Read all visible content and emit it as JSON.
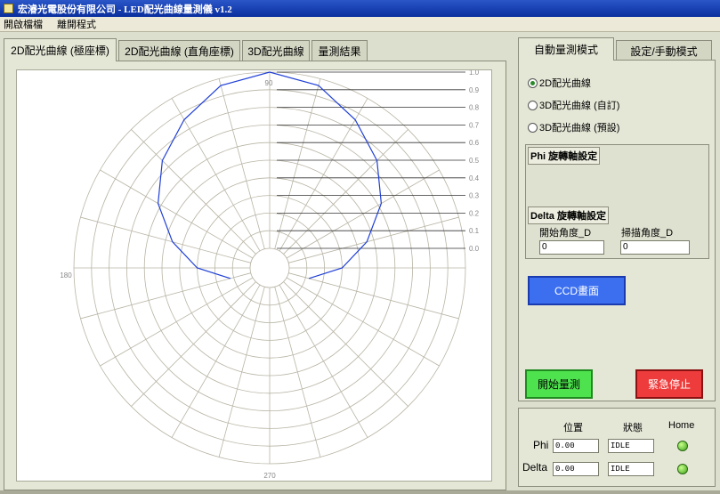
{
  "window": {
    "title": "宏濬光電股份有限公司 - LED配光曲線量測儀 v1.2"
  },
  "menu": [
    "開啟檔檔",
    "離開程式"
  ],
  "left_tabs": [
    "2D配光曲線 (極座標)",
    "2D配光曲線 (直角座標)",
    "3D配光曲線",
    "量測結果"
  ],
  "right_tabs": [
    "自動量測模式",
    "設定/手動模式"
  ],
  "polar_plot": {
    "angle_labels": {
      "top": "90",
      "left": "180",
      "bottom": "270"
    },
    "radial_ticks": [
      "1.0",
      "0.9",
      "0.8",
      "0.7",
      "0.6",
      "0.5",
      "0.4",
      "0.3",
      "0.2",
      "0.1",
      "0.0"
    ],
    "curve_color": "#1f3fd6",
    "grid_color": "#b8b4a4",
    "chart_data": {
      "type": "polar-line",
      "r_range": [
        0,
        1
      ],
      "series": [
        {
          "theta_deg": [
            -15,
            0,
            15,
            30,
            45,
            60,
            75,
            90,
            105,
            120,
            135,
            150,
            165,
            180,
            195
          ],
          "r": [
            0.12,
            0.3,
            0.46,
            0.62,
            0.75,
            0.86,
            0.96,
            1.0,
            0.96,
            0.86,
            0.75,
            0.62,
            0.46,
            0.3,
            0.12
          ]
        }
      ]
    }
  },
  "auto_mode": {
    "radio_options": [
      "2D配光曲線",
      "3D配光曲線 (自訂)",
      "3D配光曲線 (預設)"
    ],
    "selected_index": 0,
    "phi_group_label": "Phi 旋轉軸設定",
    "delta_group_label": "Delta 旋轉軸設定",
    "start_angle_label": "開始角度_D",
    "scan_angle_label": "掃描角度_D",
    "start_angle_value": "0",
    "scan_angle_value": "0",
    "ccd_button": "CCD畫面",
    "start_button": "開始量測",
    "stop_button": "緊急停止"
  },
  "status": {
    "col_position": "位置",
    "col_state": "狀態",
    "col_home": "Home",
    "rows": [
      {
        "name": "Phi",
        "position": "0.00",
        "state": "IDLE"
      },
      {
        "name": "Delta",
        "position": "0.00",
        "state": "IDLE"
      }
    ]
  }
}
